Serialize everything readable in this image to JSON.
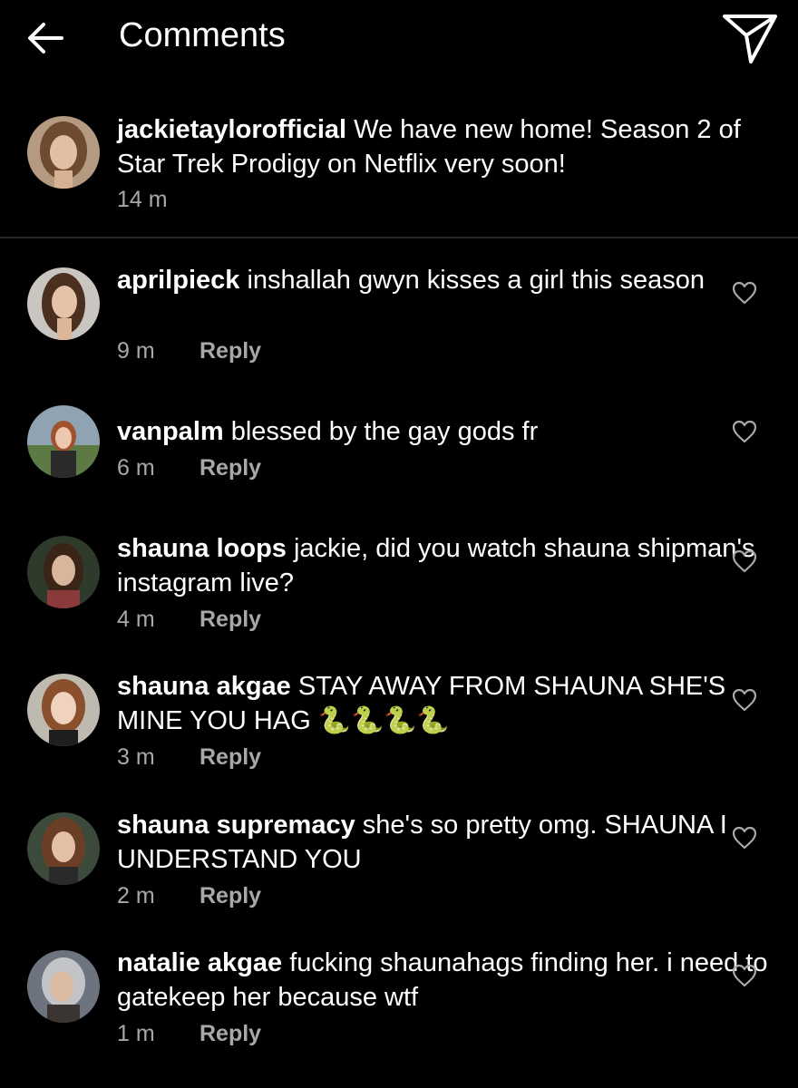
{
  "header": {
    "title": "Comments"
  },
  "caption": {
    "username": "jackietaylorofficial",
    "text": "We have new home! Season 2 of Star Trek Prodigy on Netflix very soon!",
    "time": "14 m"
  },
  "reply_label": "Reply",
  "comments": [
    {
      "username": "aprilpieck",
      "text": "inshallah gwyn kisses a girl this season",
      "time": "9 m"
    },
    {
      "username": "vanpalm",
      "text": "blessed by the gay gods fr",
      "time": "6 m"
    },
    {
      "username": "shauna loops",
      "text": "jackie, did you watch shauna shipman's instagram live?",
      "time": "4 m"
    },
    {
      "username": "shauna akgae",
      "text": "STAY AWAY FROM SHAUNA SHE'S MINE YOU HAG 🐍🐍🐍🐍",
      "time": "3 m"
    },
    {
      "username": "shauna supremacy",
      "text": "she's so pretty omg. SHAUNA I UNDERSTAND YOU",
      "time": "2 m"
    },
    {
      "username": "natalie akgae",
      "text": "fucking shaunahags finding her. i need to gatekeep her because wtf",
      "time": "1 m"
    }
  ],
  "colors": {
    "background": "#000000",
    "secondary_text": "#a8a8a8",
    "divider": "#262626"
  }
}
